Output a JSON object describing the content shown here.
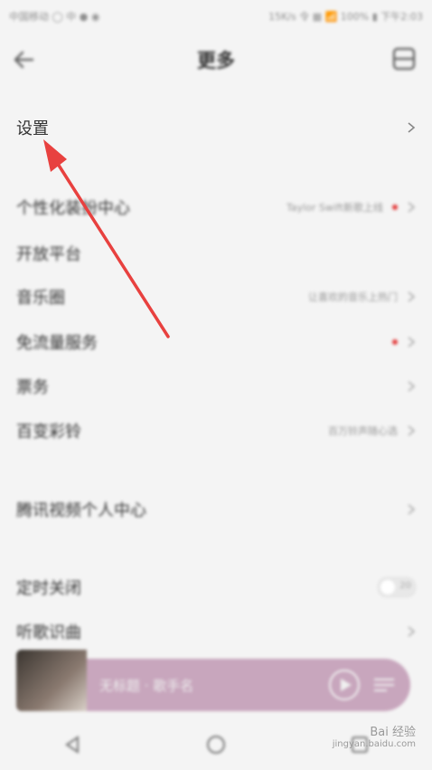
{
  "statusbar": {
    "left": "中国移动 ◯ 中 ● ◉",
    "right": "15K/s 令 ▦ 📶 100% ▮ 下午2:03"
  },
  "topbar": {
    "title": "更多"
  },
  "rows": [
    {
      "label": "设置",
      "hint": "",
      "dot": false
    },
    {
      "label": "个性化装扮中心",
      "hint": "Taylor Swift新歌上线",
      "dot": true
    },
    {
      "label": "开放平台",
      "hint": "",
      "dot": false
    },
    {
      "label": "音乐圈",
      "hint": "让喜欢的音乐上热门",
      "dot": false
    },
    {
      "label": "免流量服务",
      "hint": "",
      "dot": true
    },
    {
      "label": "票务",
      "hint": "",
      "dot": false
    },
    {
      "label": "百变彩铃",
      "hint": "百万铃声随心选",
      "dot": false
    },
    {
      "label": "腾讯视频个人中心",
      "hint": "",
      "dot": false
    },
    {
      "label": "定时关闭",
      "hint": "",
      "dot": false,
      "toggle": "20"
    },
    {
      "label": "听歌识曲",
      "hint": "",
      "dot": false
    }
  ],
  "player": {
    "song": "无标题 · 歌手名"
  },
  "watermark": {
    "line1": "Bai 经验",
    "line2": "jingyan.baidu.com"
  },
  "colors": {
    "accent": "#e33a3a",
    "player_bg": "#c8a6bd"
  }
}
